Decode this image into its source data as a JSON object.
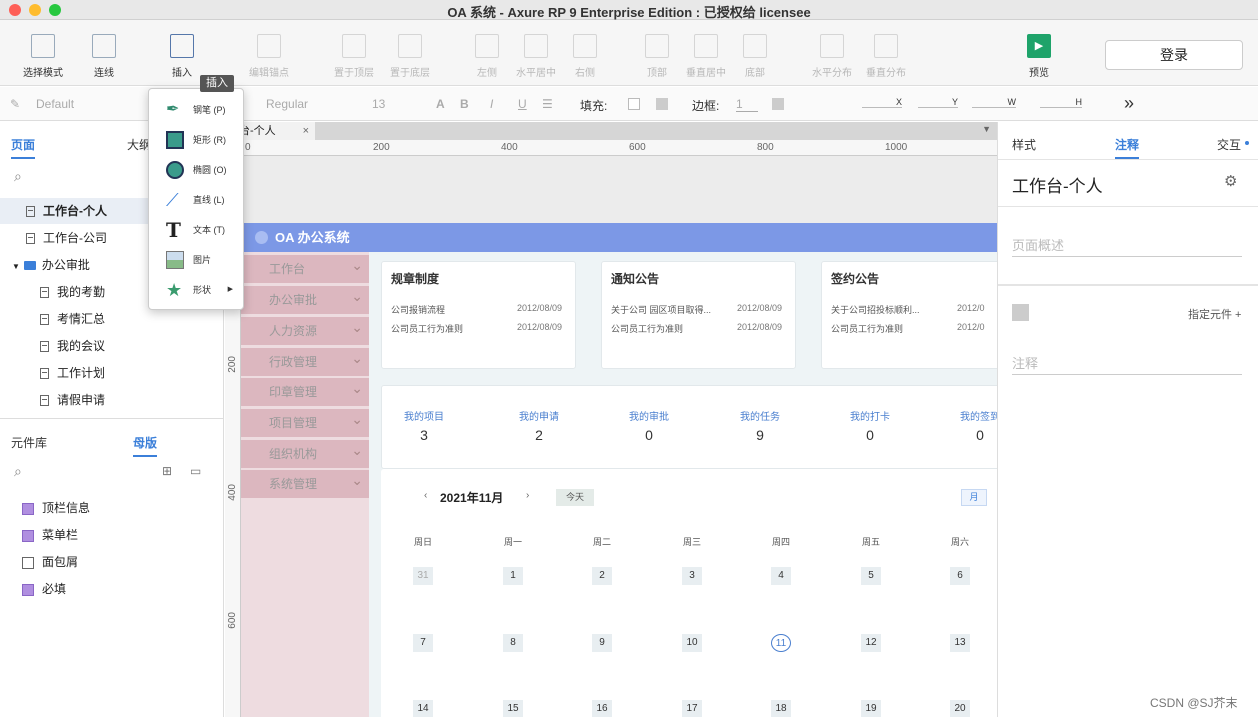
{
  "window": {
    "title": "OA 系统 - Axure RP 9 Enterprise Edition : 已授权给 licensee"
  },
  "toolbar": {
    "select_mode": "选择模式",
    "connect": "连线",
    "insert": "插入",
    "edit_points": "编辑锚点",
    "bring_front": "置于顶层",
    "send_back": "置于底层",
    "left": "左侧",
    "center_h": "水平居中",
    "right": "右侧",
    "top": "顶部",
    "center_v": "垂直居中",
    "bottom": "底部",
    "dist_h": "水平分布",
    "dist_v": "垂直分布",
    "preview": "预览",
    "login": "登录"
  },
  "format": {
    "style": "Default",
    "font": "Regular",
    "size": "13",
    "fill_label": "填充:",
    "border_label": "边框:",
    "border_width": "1",
    "x": "X",
    "y": "Y",
    "w": "W",
    "h": "H",
    "more": "»"
  },
  "left_panel": {
    "tab_pages": "页面",
    "tab_outline": "大纲",
    "pages": [
      "工作台-个人",
      "工作台-公司",
      "办公审批",
      "我的考勤",
      "考情汇总",
      "我的会议",
      "工作计划",
      "请假申请"
    ],
    "tab_library": "元件库",
    "tab_masters": "母版",
    "masters": [
      "顶栏信息",
      "菜单栏",
      "面包屑",
      "必填"
    ]
  },
  "canvas": {
    "tab": "台-个人",
    "ruler_h": [
      "0",
      "200",
      "400",
      "600",
      "800",
      "1000"
    ],
    "ruler_v": [
      "200",
      "400",
      "600"
    ]
  },
  "oa": {
    "header": "OA 办公系统",
    "menu": [
      "工作台",
      "办公审批",
      "人力资源",
      "行政管理",
      "印章管理",
      "项目管理",
      "组织机构",
      "系统管理"
    ],
    "cards": [
      {
        "title": "规章制度",
        "rows": [
          {
            "t": "公司报销流程",
            "d": "2012/08/09"
          },
          {
            "t": "公司员工行为准则",
            "d": "2012/08/09"
          }
        ]
      },
      {
        "title": "通知公告",
        "rows": [
          {
            "t": "关于公司 园区项目取得...",
            "d": "2012/08/09"
          },
          {
            "t": "公司员工行为准则",
            "d": "2012/08/09"
          }
        ]
      },
      {
        "title": "签约公告",
        "rows": [
          {
            "t": "关于公司招投标顺利...",
            "d": "2012/0"
          },
          {
            "t": "公司员工行为准则",
            "d": "2012/0"
          }
        ]
      }
    ],
    "stats": [
      {
        "l": "我的项目",
        "v": "3"
      },
      {
        "l": "我的申请",
        "v": "2"
      },
      {
        "l": "我的审批",
        "v": "0"
      },
      {
        "l": "我的任务",
        "v": "9"
      },
      {
        "l": "我的打卡",
        "v": "0"
      },
      {
        "l": "我的签到",
        "v": "0"
      }
    ],
    "calendar": {
      "month": "2021年11月",
      "today": "今天",
      "view": "月",
      "weekdays": [
        "周日",
        "周一",
        "周二",
        "周三",
        "周四",
        "周五",
        "周六"
      ],
      "rows": [
        [
          "31",
          "1",
          "2",
          "3",
          "4",
          "5",
          "6"
        ],
        [
          "7",
          "8",
          "9",
          "10",
          "11",
          "12",
          "13"
        ],
        [
          "14",
          "15",
          "16",
          "17",
          "18",
          "19",
          "20"
        ]
      ]
    }
  },
  "right_panel": {
    "tab_style": "样式",
    "tab_notes": "注释",
    "tab_interact": "交互",
    "page_name": "工作台-个人",
    "page_desc_ph": "页面概述",
    "assign": "指定元件 +",
    "notes_ph": "注释"
  },
  "insert_menu": {
    "tooltip": "插入",
    "items": [
      "钢笔 (P)",
      "矩形 (R)",
      "椭圆 (O)",
      "直线 (L)",
      "文本 (T)",
      "图片",
      "形状"
    ]
  },
  "watermark": "CSDN @SJ芥末"
}
